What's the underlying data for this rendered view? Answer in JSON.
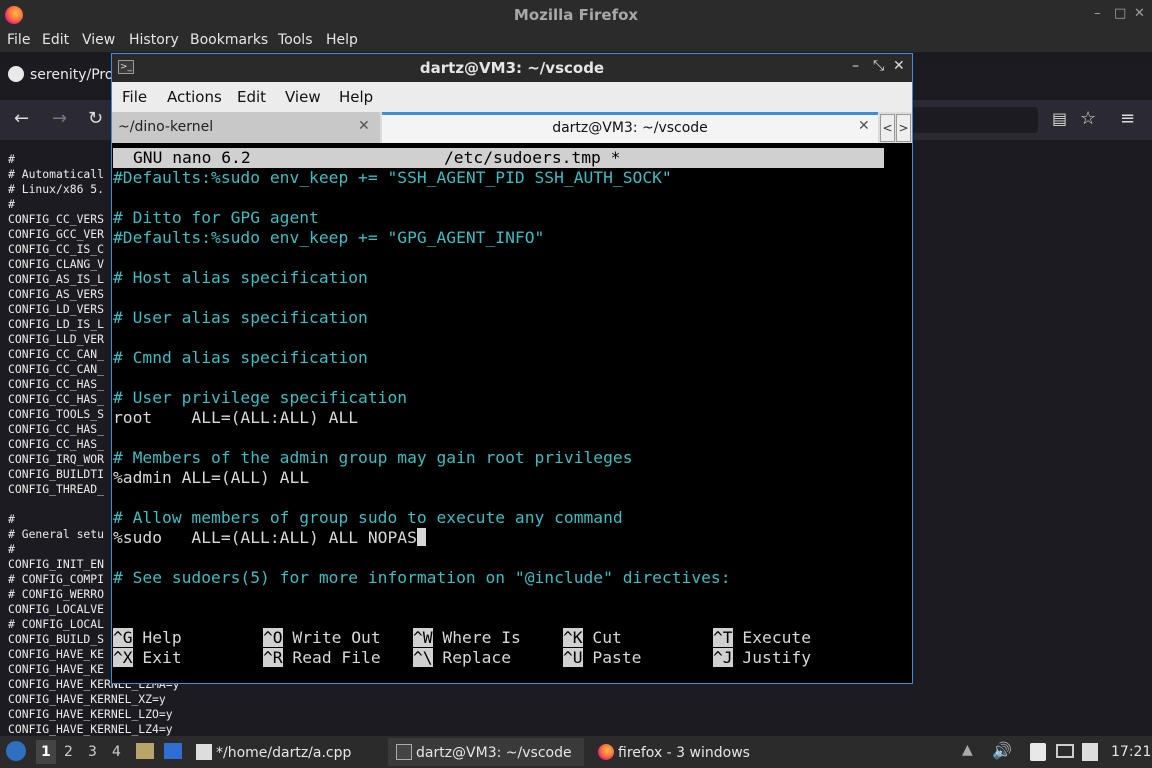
{
  "firefox": {
    "title": "Mozilla Firefox",
    "window_controls": {
      "minimize": "–",
      "maximize": "□",
      "close": "✕"
    },
    "menu": [
      "File",
      "Edit",
      "View",
      "History",
      "Bookmarks",
      "Tools",
      "Help"
    ],
    "tab_label": "serenity/Pro",
    "page_lines": [
      "#",
      "# Automaticall",
      "# Linux/x86 5.",
      "#",
      "CONFIG_CC_VERS",
      "CONFIG_GCC_VER",
      "CONFIG_CC_IS_C",
      "CONFIG_CLANG_V",
      "CONFIG_AS_IS_L",
      "CONFIG_AS_VERS",
      "CONFIG_LD_VERS",
      "CONFIG_LD_IS_L",
      "CONFIG_LLD_VER",
      "CONFIG_CC_CAN_",
      "CONFIG_CC_CAN_",
      "CONFIG_CC_HAS_",
      "CONFIG_CC_HAS_",
      "CONFIG_TOOLS_S",
      "CONFIG_CC_HAS_",
      "CONFIG_CC_HAS_",
      "CONFIG_IRQ_WOR",
      "CONFIG_BUILDTI",
      "CONFIG_THREAD_",
      "",
      "#",
      "# General setu",
      "#",
      "CONFIG_INIT_EN",
      "# CONFIG_COMPI",
      "# CONFIG_WERRO",
      "CONFIG_LOCALVE",
      "# CONFIG_LOCAL",
      "CONFIG_BUILD_S",
      "CONFIG_HAVE_KE",
      "CONFIG_HAVE_KE",
      "CONFIG_HAVE_KERNEL_LZMA=y",
      "CONFIG_HAVE_KERNEL_XZ=y",
      "CONFIG_HAVE_KERNEL_LZO=y",
      "CONFIG_HAVE_KERNEL_LZ4=y"
    ]
  },
  "terminal": {
    "title": "dartz@VM3: ~/vscode",
    "window_controls": {
      "minimize": "–",
      "restore": "⤡",
      "close": "✕"
    },
    "menu": [
      "File",
      "Actions",
      "Edit",
      "View",
      "Help"
    ],
    "tabs": [
      {
        "label": "~/dino-kernel",
        "close": "✕"
      },
      {
        "label": "dartz@VM3: ~/vscode",
        "close": "✕"
      }
    ],
    "scroll_left": "<",
    "scroll_right": ">"
  },
  "nano": {
    "header_app": "GNU nano 6.2",
    "header_file": "/etc/sudoers.tmp *",
    "lines": [
      {
        "text": "#Defaults:%sudo env_keep += \"SSH_AGENT_PID SSH_AUTH_SOCK\"",
        "kind": "cmt"
      },
      {
        "text": "",
        "kind": "txt"
      },
      {
        "text": "# Ditto for GPG agent",
        "kind": "cmt"
      },
      {
        "text": "#Defaults:%sudo env_keep += \"GPG_AGENT_INFO\"",
        "kind": "cmt"
      },
      {
        "text": "",
        "kind": "txt"
      },
      {
        "text": "# Host alias specification",
        "kind": "cmt"
      },
      {
        "text": "",
        "kind": "txt"
      },
      {
        "text": "# User alias specification",
        "kind": "cmt"
      },
      {
        "text": "",
        "kind": "txt"
      },
      {
        "text": "# Cmnd alias specification",
        "kind": "cmt"
      },
      {
        "text": "",
        "kind": "txt"
      },
      {
        "text": "# User privilege specification",
        "kind": "cmt"
      },
      {
        "text": "root    ALL=(ALL:ALL) ALL",
        "kind": "txt"
      },
      {
        "text": "",
        "kind": "txt"
      },
      {
        "text": "# Members of the admin group may gain root privileges",
        "kind": "cmt"
      },
      {
        "text": "%admin ALL=(ALL) ALL",
        "kind": "txt"
      },
      {
        "text": "",
        "kind": "txt"
      },
      {
        "text": "# Allow members of group sudo to execute any command",
        "kind": "cmt"
      },
      {
        "text": "%sudo   ALL=(ALL:ALL) ALL NOPAS",
        "kind": "txt",
        "cursor": true
      },
      {
        "text": "",
        "kind": "txt"
      },
      {
        "text": "# See sudoers(5) for more information on \"@include\" directives:",
        "kind": "cmt"
      }
    ],
    "shortcuts": [
      [
        {
          "key": "^G",
          "label": "Help"
        },
        {
          "key": "^O",
          "label": "Write Out"
        },
        {
          "key": "^W",
          "label": "Where Is"
        },
        {
          "key": "^K",
          "label": "Cut"
        },
        {
          "key": "^T",
          "label": "Execute"
        }
      ],
      [
        {
          "key": "^X",
          "label": "Exit"
        },
        {
          "key": "^R",
          "label": "Read File"
        },
        {
          "key": "^\\",
          "label": "Replace"
        },
        {
          "key": "^U",
          "label": "Paste"
        },
        {
          "key": "^J",
          "label": "Justify"
        }
      ]
    ]
  },
  "taskbar": {
    "workspaces": [
      "1",
      "2",
      "3",
      "4"
    ],
    "tasks": [
      {
        "label": "*/home/dartz/a.cpp"
      },
      {
        "label": "dartz@VM3: ~/vscode"
      },
      {
        "label": "firefox - 3 windows"
      }
    ],
    "clock": "17:21"
  }
}
